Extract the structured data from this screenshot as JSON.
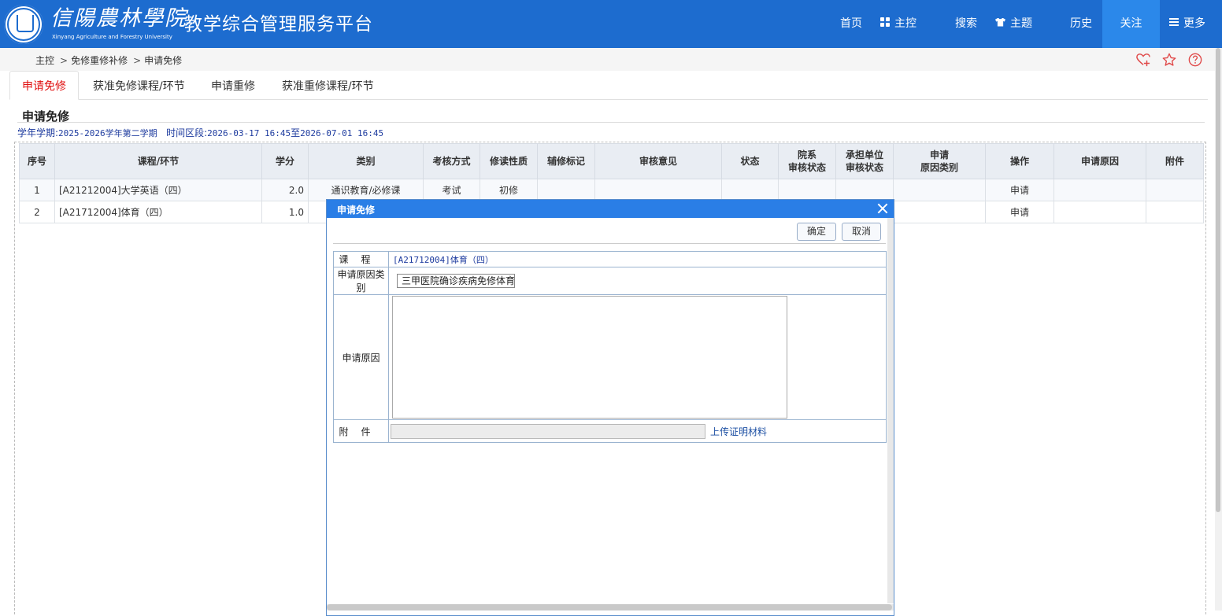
{
  "header": {
    "logo_cn": "信陽農林學院",
    "logo_en": "Xinyang Agriculture and Forestry University",
    "site_title": "教学综合管理服务平台",
    "nav": {
      "home": "首页",
      "main": "主控",
      "search": "搜索",
      "theme": "主题",
      "history": "历史",
      "follow": "关注",
      "more": "更多"
    }
  },
  "breadcrumb": [
    "主控",
    "免修重修补修",
    "申请免修"
  ],
  "tabs": [
    "申请免修",
    "获准免修课程/环节",
    "申请重修",
    "获准重修课程/环节"
  ],
  "section": {
    "title": "申请免修",
    "term_label": "学年学期:",
    "term_value": "2025-2026学年第二学期",
    "period_label": "时间区段:",
    "period_start": "2026-03-17 16:45",
    "period_to": "至",
    "period_end": "2026-07-01 16:45"
  },
  "table": {
    "headers": [
      "序号",
      "课程/环节",
      "学分",
      "类别",
      "考核方式",
      "修读性质",
      "辅修标记",
      "审核意见",
      "状态",
      "院系\n审核状态",
      "承担单位\n审核状态",
      "申请\n原因类别",
      "操作",
      "申请原因",
      "附件"
    ],
    "rows": [
      {
        "no": "1",
        "course": "[A21212004]大学英语（四）",
        "credit": "2.0",
        "category": "通识教育/必修课",
        "exam": "考试",
        "nature": "初修",
        "minor": "",
        "opinion": "",
        "status": "",
        "dept": "",
        "unit": "",
        "reason_type": "",
        "op": "申请",
        "reason": "",
        "attach": ""
      },
      {
        "no": "2",
        "course": "[A21712004]体育（四）",
        "credit": "1.0",
        "category": "",
        "exam": "",
        "nature": "",
        "minor": "",
        "opinion": "",
        "status": "",
        "dept": "",
        "unit": "",
        "reason_type": "",
        "op": "申请",
        "reason": "",
        "attach": ""
      }
    ]
  },
  "modal": {
    "title": "申请免修",
    "ok": "确定",
    "cancel": "取消",
    "course_label": "课程",
    "course_value": "[A21712004]体育（四）",
    "reason_type_label": "申请原因类别",
    "reason_type_value": "三甲医院确诊疾病免修体育",
    "reason_label": "申请原因",
    "reason_value": "",
    "attach_label": "附件",
    "upload_label": "上传证明材料"
  },
  "colors": {
    "header_bg": "#1d6ccf",
    "follow_bg": "#2b88ea",
    "active_tab": "#e01010",
    "modal_header": "#2a7ee6",
    "link": "#2f6dc6",
    "term_text": "#1c3a9e"
  }
}
